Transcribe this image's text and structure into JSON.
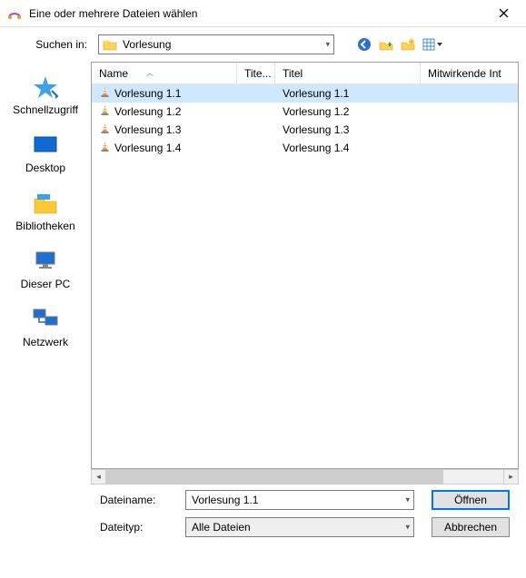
{
  "window": {
    "title": "Eine oder mehrere Dateien wählen"
  },
  "toolbar": {
    "look_in_label": "Suchen in:",
    "look_in_value": "Vorlesung"
  },
  "places": [
    {
      "id": "quick",
      "label": "Schnellzugriff"
    },
    {
      "id": "desktop",
      "label": "Desktop"
    },
    {
      "id": "libs",
      "label": "Bibliotheken"
    },
    {
      "id": "thispc",
      "label": "Dieser PC"
    },
    {
      "id": "network",
      "label": "Netzwerk"
    }
  ],
  "columns": {
    "name": "Name",
    "tite": "Tite...",
    "titel": "Titel",
    "mit": "Mitwirkende Int"
  },
  "files": [
    {
      "name": "Vorlesung 1.1",
      "titel": "Vorlesung 1.1",
      "selected": true
    },
    {
      "name": "Vorlesung 1.2",
      "titel": "Vorlesung 1.2",
      "selected": false
    },
    {
      "name": "Vorlesung 1.3",
      "titel": "Vorlesung 1.3",
      "selected": false
    },
    {
      "name": "Vorlesung 1.4",
      "titel": "Vorlesung 1.4",
      "selected": false
    }
  ],
  "bottom": {
    "filename_label": "Dateiname:",
    "filename_value": "Vorlesung 1.1",
    "filetype_label": "Dateityp:",
    "filetype_value": "Alle Dateien",
    "open_label": "Öffnen",
    "cancel_label": "Abbrechen"
  }
}
